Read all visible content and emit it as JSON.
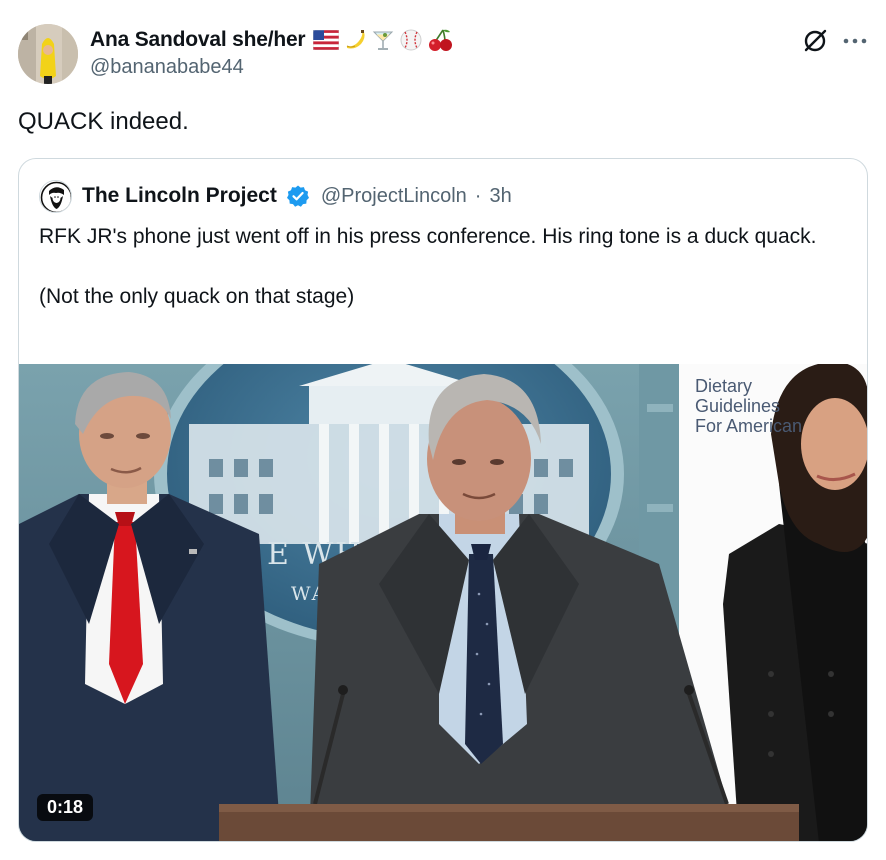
{
  "post": {
    "author": {
      "display_name": "Ana Sandoval she/her",
      "name_emojis": [
        "us-flag-emoji",
        "banana-emoji",
        "cocktail-emoji",
        "baseball-emoji",
        "cherries-emoji"
      ],
      "handle": "@bananababe44"
    },
    "text": "QUACK indeed.",
    "actions": {
      "grok_icon": "grok-icon",
      "more_icon": "more-horizontal-icon"
    }
  },
  "quote": {
    "author": {
      "display_name": "The Lincoln Project",
      "verified": true,
      "verified_color": "#1d9bf0",
      "handle": "@ProjectLincoln",
      "separator": "·",
      "time": "3h"
    },
    "text_line_1": "RFK JR's phone just went off in his press conference. His ring tone is a duck quack.",
    "text_line_2": "(Not the only quack on that stage)",
    "media": {
      "type": "video",
      "duration": "0:18",
      "caption_lines": [
        "Dietary",
        "Guidelines",
        "For American"
      ],
      "backdrop_text_1": "E WHITE",
      "backdrop_text_2": "WASH"
    }
  },
  "colors": {
    "text_primary": "#0f1419",
    "text_secondary": "#536471",
    "border": "#cfd9de"
  }
}
